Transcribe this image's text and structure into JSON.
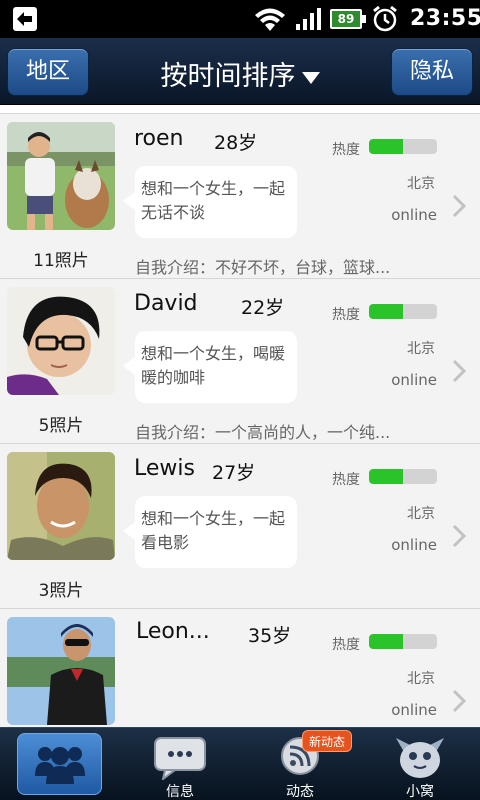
{
  "status_bar": {
    "battery": "89",
    "time": "23:55",
    "icons": [
      "back-notification-icon",
      "wifi-icon",
      "signal-icon",
      "battery-icon",
      "alarm-icon"
    ]
  },
  "title_bar": {
    "left_button": "地区",
    "title": "按时间排序",
    "right_button": "隐私"
  },
  "profiles": [
    {
      "name": "roen",
      "age": "28岁",
      "message": "想和一个女生，一起无话不谈",
      "heat_label": "热度",
      "heat_level": 0.5,
      "city": "北京",
      "status": "online",
      "photo_count": "11照片",
      "intro": "自我介绍：不好不坏，台球，篮球..."
    },
    {
      "name": "David",
      "age": "22岁",
      "message": "想和一个女生，喝暖暖的咖啡",
      "heat_label": "热度",
      "heat_level": 0.5,
      "city": "北京",
      "status": "online",
      "photo_count": "5照片",
      "intro": "自我介绍：一个高尚的人，一个纯..."
    },
    {
      "name": "Lewis",
      "age": "27岁",
      "message": "想和一个女生，一起看电影",
      "heat_label": "热度",
      "heat_level": 0.5,
      "city": "北京",
      "status": "online",
      "photo_count": "3照片",
      "intro": ""
    },
    {
      "name": "Leon...",
      "age": "35岁",
      "message": "",
      "heat_label": "热度",
      "heat_level": 0.5,
      "city": "北京",
      "status": "online",
      "photo_count": "",
      "intro": ""
    }
  ],
  "bottom_tabs": [
    {
      "label": "",
      "icon": "friends-icon",
      "active": true
    },
    {
      "label": "信息",
      "icon": "chat-bubble-icon",
      "active": false
    },
    {
      "label": "动态",
      "icon": "rss-icon",
      "active": false,
      "badge": "新动态"
    },
    {
      "label": "小窝",
      "icon": "mascot-icon",
      "active": false
    }
  ],
  "colors": {
    "title_bar": "#0f213a",
    "button_blue": "#2b5c9a",
    "heat_green": "#2ac42a",
    "badge_orange": "#e5531f"
  }
}
